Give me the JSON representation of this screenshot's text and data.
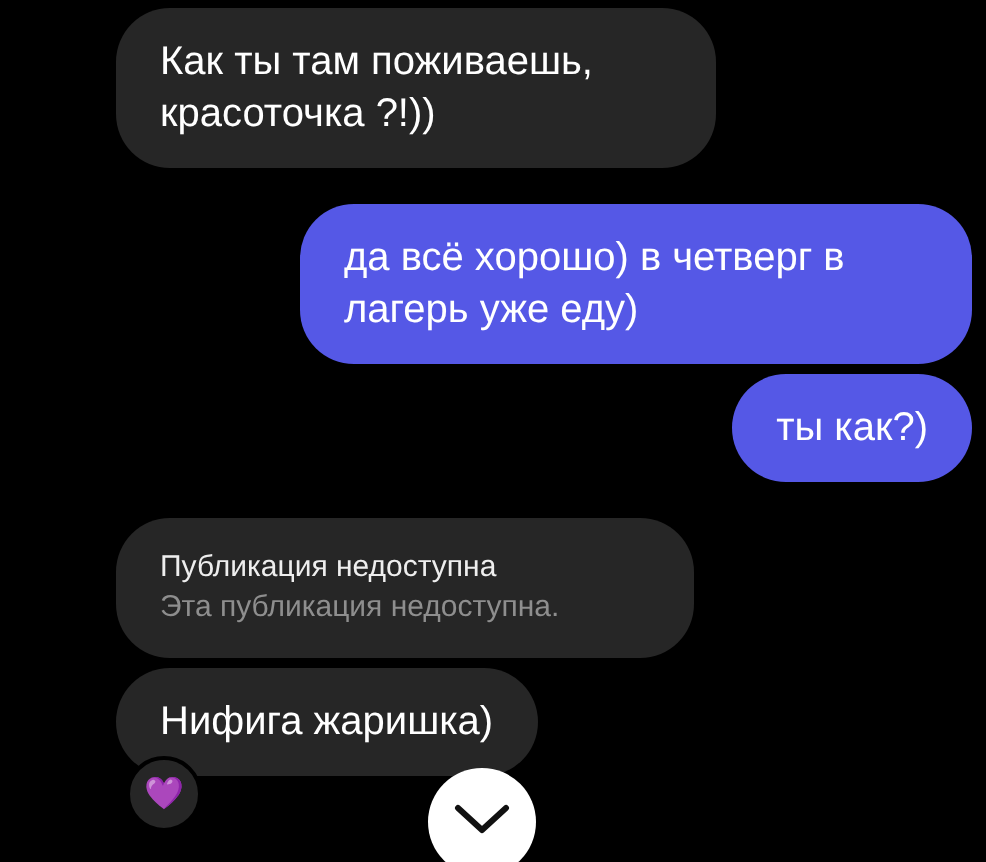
{
  "messages": [
    {
      "outgoing": false,
      "kind": "text",
      "text": "Как ты там поживаешь, красоточка ?!))"
    },
    {
      "outgoing": true,
      "kind": "text",
      "text": "да всё хорошо) в четверг в лагерь уже еду)"
    },
    {
      "outgoing": true,
      "kind": "text",
      "text": "ты как?)"
    },
    {
      "outgoing": false,
      "kind": "unavailable",
      "title": "Публикация недоступна",
      "subtitle": "Эта публикация недоступна."
    },
    {
      "outgoing": false,
      "kind": "text",
      "text": "Нифига жаришка)",
      "reaction": "💜"
    }
  ]
}
